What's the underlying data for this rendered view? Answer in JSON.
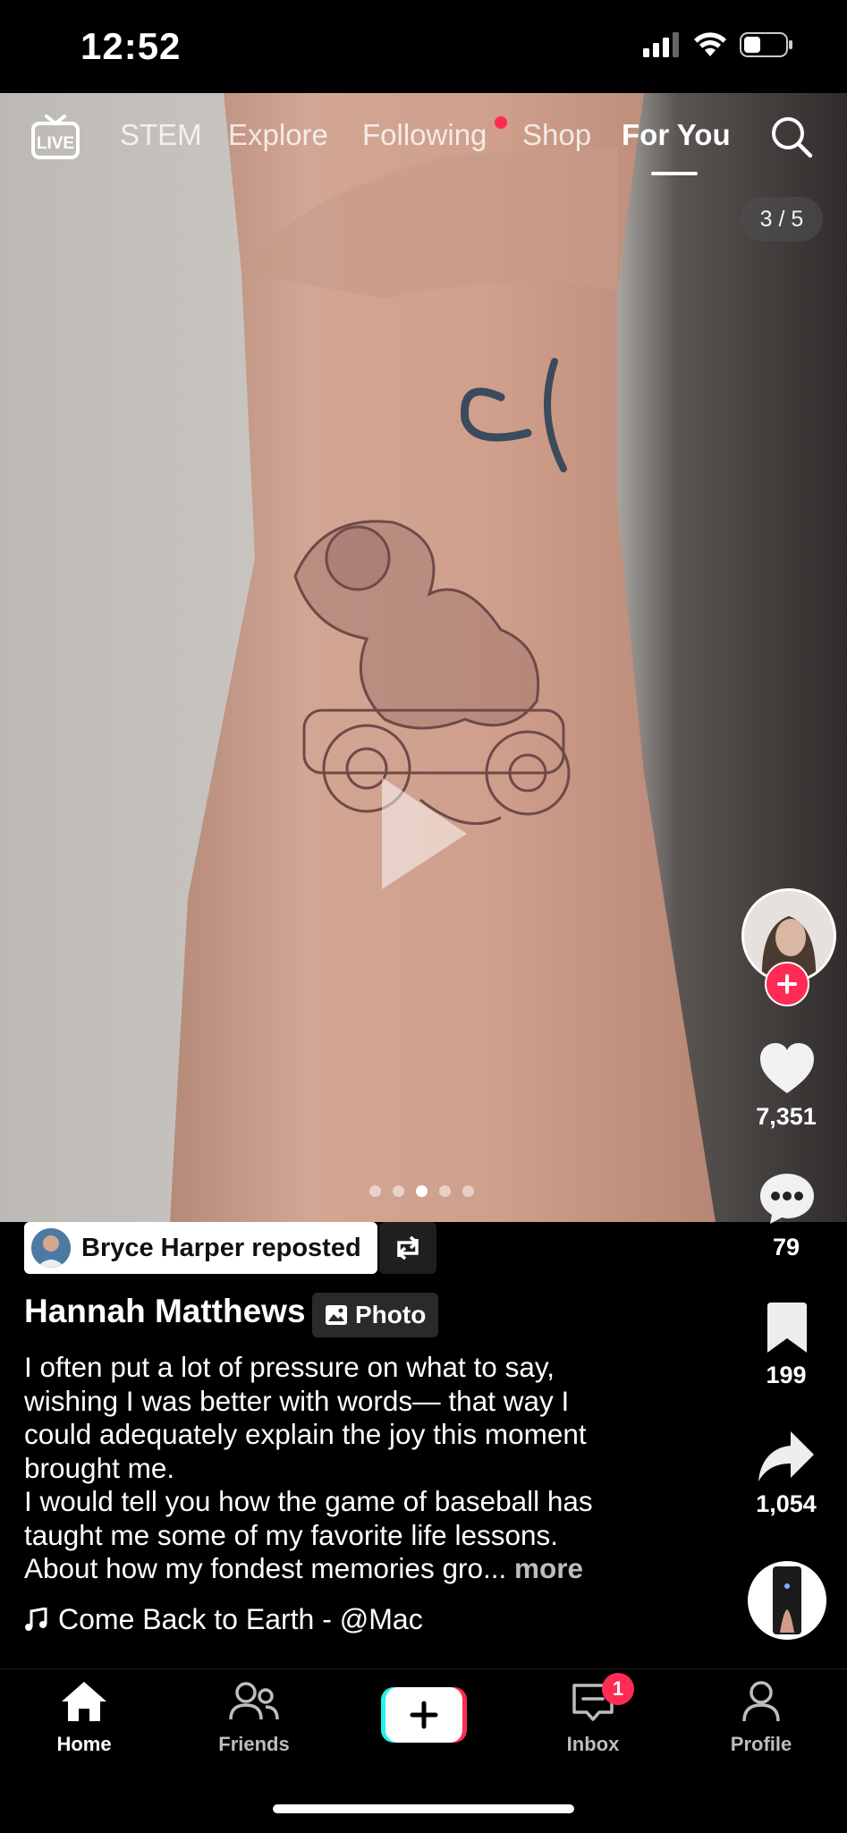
{
  "status_bar": {
    "time": "12:52"
  },
  "top_nav": {
    "tabs": [
      {
        "label": "STEM"
      },
      {
        "label": "Explore"
      },
      {
        "label": "Following"
      },
      {
        "label": "Shop"
      },
      {
        "label": "For You",
        "active": true
      }
    ]
  },
  "photo": {
    "counter": "3 / 5",
    "dots_total": 5,
    "dots_active": 3
  },
  "right_rail": {
    "likes": "7,351",
    "comments": "79",
    "saves": "199",
    "shares": "1,054"
  },
  "post": {
    "repost_label": "Bryce Harper reposted",
    "author": "Hannah Matthews",
    "type_label": "Photo",
    "caption_lines": [
      "I often put a lot of pressure on what to say,",
      "wishing I was better with words— that way I",
      "could adequately explain the joy this moment",
      "brought me.",
      "I would tell you how the game of baseball has",
      "taught me some of my favorite life lessons."
    ],
    "caption_last": "About how my fondest memories gro... ",
    "more_label": "more",
    "music": "Come Back to Earth - @Mac"
  },
  "bottom_nav": {
    "home": "Home",
    "friends": "Friends",
    "inbox": "Inbox",
    "inbox_badge": "1",
    "profile": "Profile"
  },
  "colors": {
    "accent": "#fe2c55",
    "tiktok_cyan": "#25f4ee"
  }
}
